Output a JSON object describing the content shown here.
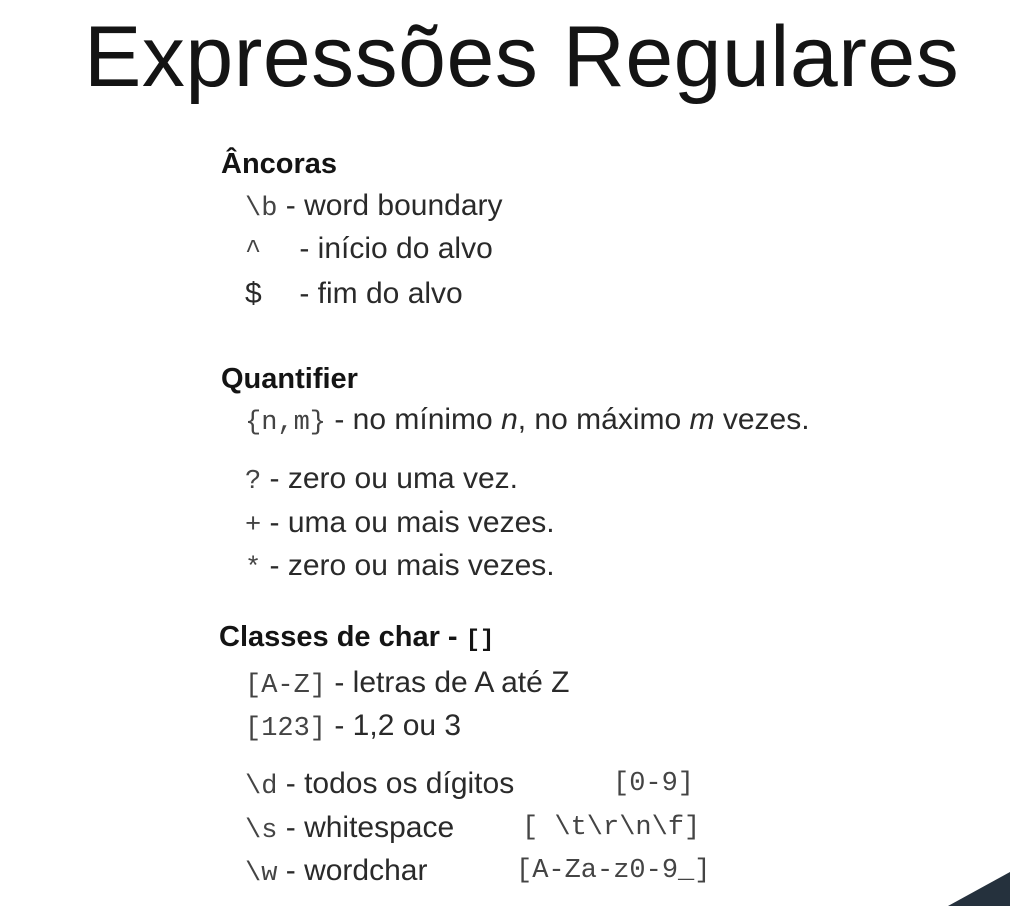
{
  "title": "Expressões Regulares",
  "anchors": {
    "heading": "Âncoras",
    "items": [
      {
        "code": "\\b",
        "desc": " - word boundary"
      },
      {
        "code": "^",
        "desc": " - início do alvo"
      },
      {
        "code": "$",
        "desc": " - fim do alvo"
      }
    ]
  },
  "quantifier": {
    "heading": "Quantifier",
    "range": {
      "code": "{n,m}",
      "t1": " - no mínimo ",
      "n": "n",
      "t2": ", no máximo ",
      "m": "m",
      "t3": " vezes."
    },
    "items": [
      {
        "code": "?",
        "desc": " - zero ou uma vez."
      },
      {
        "code": "+",
        "desc": " - uma ou mais vezes."
      },
      {
        "code": "*",
        "desc": " - zero ou mais vezes."
      }
    ]
  },
  "classes": {
    "heading": "Classes de char - ",
    "heading_code": "[]",
    "items": [
      {
        "code": "[A-Z]",
        "desc": " - letras de A até Z",
        "equiv": ""
      },
      {
        "code": "[123]",
        "desc": " - 1,2 ou 3",
        "equiv": ""
      },
      {
        "code": "\\d",
        "desc": " - todos os dígitos",
        "equiv": "[0-9]"
      },
      {
        "code": "\\s",
        "desc": " - whitespace",
        "equiv": "[ \\t\\r\\n\\f]"
      },
      {
        "code": "\\w",
        "desc": " - wordchar",
        "equiv": "[A-Za-z0-9_]"
      }
    ]
  }
}
